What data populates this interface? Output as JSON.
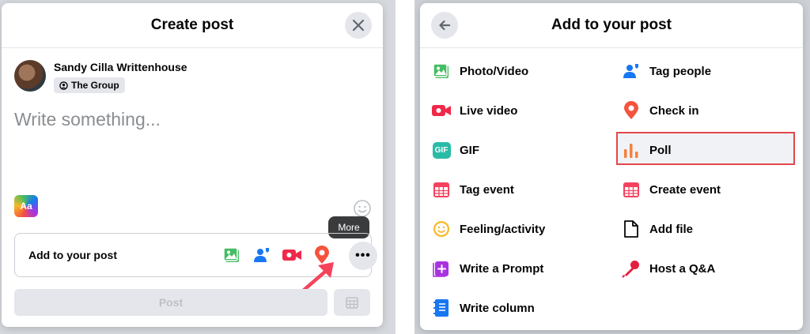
{
  "create_post": {
    "title": "Create post",
    "user_name": "Sandy Cilla Writtenhouse",
    "audience": "The Group",
    "placeholder": "Write something...",
    "aa_label": "Aa",
    "add_label": "Add to your post",
    "add_icons": [
      "photo-video-icon",
      "tag-people-icon",
      "live-video-icon",
      "check-in-icon"
    ],
    "more_label": "•••",
    "tooltip": "More",
    "post_button": "Post"
  },
  "add_to_post": {
    "title": "Add to your post",
    "options_left": [
      {
        "label": "Photo/Video",
        "icon": "photo-video-icon"
      },
      {
        "label": "Live video",
        "icon": "live-video-icon"
      },
      {
        "label": "GIF",
        "icon": "gif-icon"
      },
      {
        "label": "Tag event",
        "icon": "tag-event-icon"
      },
      {
        "label": "Feeling/activity",
        "icon": "feeling-activity-icon"
      },
      {
        "label": "Write a Prompt",
        "icon": "write-prompt-icon"
      },
      {
        "label": "Write column",
        "icon": "write-column-icon"
      }
    ],
    "options_right": [
      {
        "label": "Tag people",
        "icon": "tag-people-icon"
      },
      {
        "label": "Check in",
        "icon": "check-in-icon"
      },
      {
        "label": "Poll",
        "icon": "poll-icon",
        "highlighted": true
      },
      {
        "label": "Create event",
        "icon": "create-event-icon"
      },
      {
        "label": "Add file",
        "icon": "add-file-icon"
      },
      {
        "label": "Host a Q&A",
        "icon": "host-qa-icon"
      }
    ],
    "gif_icon_text": "GIF"
  },
  "colors": {
    "green": "#45bd62",
    "blue": "#1877f2",
    "red": "#f02849",
    "orange": "#f5533d",
    "yellow": "#f7b928",
    "purple": "#a933e0",
    "teal": "#2abba7",
    "highlight": "#e2474c"
  }
}
